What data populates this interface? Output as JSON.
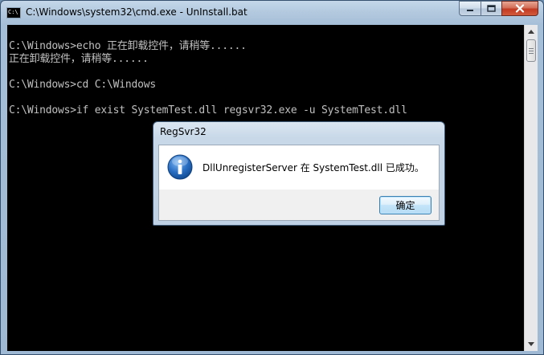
{
  "window": {
    "title": "C:\\Windows\\system32\\cmd.exe - UnInstall.bat",
    "icon_label": "C:\\"
  },
  "console": {
    "lines": [
      "C:\\Windows>echo 正在卸载控件，请稍等......",
      "正在卸载控件，请稍等......",
      "",
      "C:\\Windows>cd C:\\Windows",
      "",
      "C:\\Windows>if exist SystemTest.dll regsvr32.exe -u SystemTest.dll"
    ]
  },
  "dialog": {
    "title": "RegSvr32",
    "message": "DllUnregisterServer 在 SystemTest.dll 已成功。",
    "ok_label": "确定",
    "icon": "info-icon"
  },
  "colors": {
    "console_bg": "#000000",
    "console_text": "#c0c0c0",
    "close_button": "#c13a22",
    "info_icon": "#1a5fb4"
  }
}
